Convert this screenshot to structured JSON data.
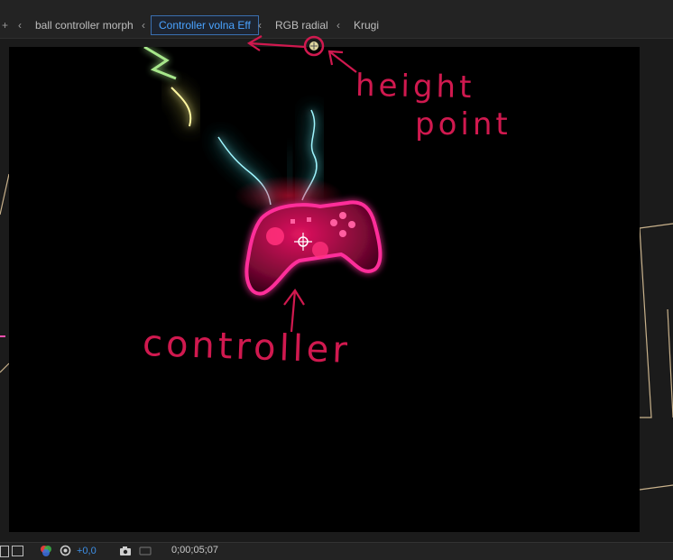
{
  "breadcrumbs": [
    {
      "label": "ball controller morph"
    },
    {
      "label": "Controller volna Eff"
    },
    {
      "label": "RGB radial"
    },
    {
      "label": "Krugi"
    }
  ],
  "annotations": {
    "height_point": [
      "height",
      "point"
    ],
    "controller": "controller"
  },
  "bottom_bar": {
    "exposure": "+0,0",
    "timecode": "0;00;05;07"
  },
  "colors": {
    "accent": "#4aa3ff",
    "annotation": "#d0194f",
    "controller_pink": "#ff1f8f",
    "smoke_cyan": "#2fd7e0",
    "glow_yellow": "#e6e05a"
  }
}
